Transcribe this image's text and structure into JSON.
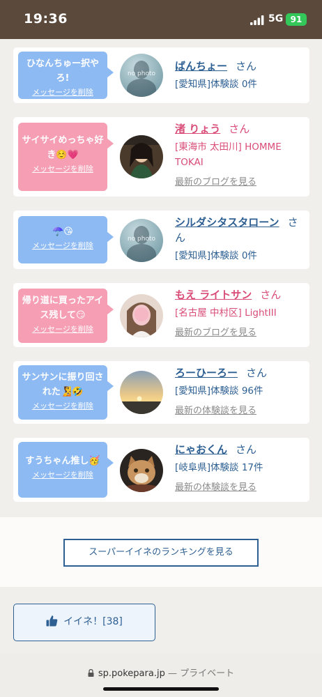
{
  "status": {
    "time": "19:36",
    "network": "5G",
    "battery": "91"
  },
  "cards": [
    {
      "bubble": "ひなんちゅー択やろ!",
      "delete": "メッセージを削除",
      "name": "ばんちょー",
      "san": "さん",
      "detail": "[愛知県]体験談 0件",
      "latest": "",
      "avatar": "no photo",
      "color": "blue"
    },
    {
      "bubble": "サイサイめっちゃ好き☺️💗",
      "delete": "メッセージを削除",
      "name": "渚 りょう",
      "san": "さん",
      "detail": "[東海市 太田川] HOMME TOKAI",
      "latest": "最新のブログを見る",
      "avatar": "photo",
      "color": "pink"
    },
    {
      "bubble": "☂️😘",
      "delete": "メッセージを削除",
      "name": "シルダシタスタローン",
      "san": "さん",
      "detail": "[愛知県]体験談 0件",
      "latest": "",
      "avatar": "no photo",
      "color": "blue"
    },
    {
      "bubble": "帰り道に買ったアイス残して😏",
      "delete": "メッセージを削除",
      "name": "もえ ライトサン",
      "san": "さん",
      "detail": "[名古屋 中村区] LightIII",
      "latest": "最新のブログを見る",
      "avatar": "photo",
      "color": "pink"
    },
    {
      "bubble": "サンサンに振り回された🧏🤣",
      "delete": "メッセージを削除",
      "name": "ろーひーろー",
      "san": "さん",
      "detail": "[愛知県]体験談 96件",
      "latest": "最新の体験談を見る",
      "avatar": "photo",
      "color": "blue"
    },
    {
      "bubble": "すうちゃん推し🥳",
      "delete": "メッセージを削除",
      "name": "にゃおくん",
      "san": "さん",
      "detail": "[岐阜県]体験談 17件",
      "latest": "最新の体験談を見る",
      "avatar": "photo",
      "color": "blue"
    }
  ],
  "ranking_button": "スーパーイイネのランキングを見る",
  "like_button": {
    "label": "イイネ！",
    "count": "[38]"
  },
  "urlbar": {
    "domain": "sp.pokepara.jp",
    "suffix": "— プライベート"
  }
}
